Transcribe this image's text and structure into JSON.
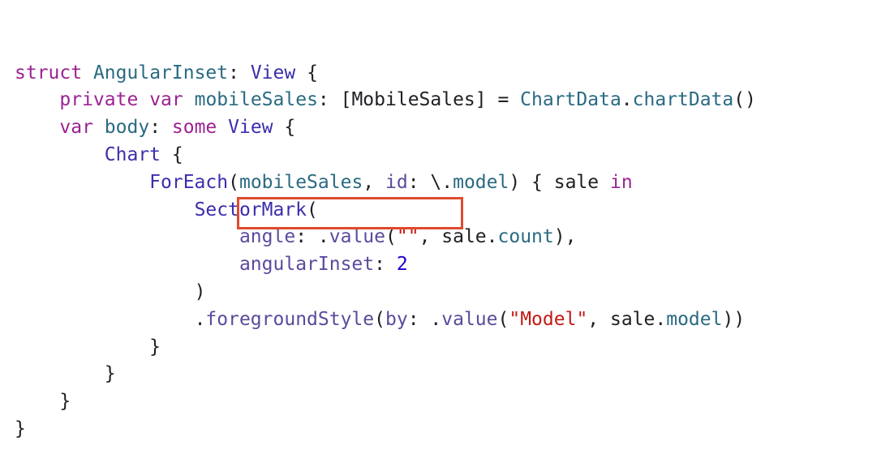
{
  "colors": {
    "keyword": "#9b2393",
    "type": "#3b2ead",
    "identifier": "#2a6a82",
    "property": "#5c4a9c",
    "string": "#c41a16",
    "number": "#1c00cf",
    "plain": "#1f1f24",
    "highlight": "#e14a2e"
  },
  "code": {
    "lines": [
      {
        "indent": "",
        "tokens": [
          {
            "t": "struct",
            "k": "keyword"
          },
          {
            "t": " ",
            "k": "plain"
          },
          {
            "t": "AngularInset",
            "k": "identifier"
          },
          {
            "t": ": ",
            "k": "plain"
          },
          {
            "t": "View",
            "k": "type"
          },
          {
            "t": " {",
            "k": "plain"
          }
        ]
      },
      {
        "indent": "    ",
        "tokens": [
          {
            "t": "private",
            "k": "keyword"
          },
          {
            "t": " ",
            "k": "plain"
          },
          {
            "t": "var",
            "k": "keyword"
          },
          {
            "t": " ",
            "k": "plain"
          },
          {
            "t": "mobileSales",
            "k": "identifier"
          },
          {
            "t": ": [MobileSales] = ",
            "k": "plain"
          },
          {
            "t": "ChartData",
            "k": "identifier"
          },
          {
            "t": ".",
            "k": "plain"
          },
          {
            "t": "chartData",
            "k": "identifier"
          },
          {
            "t": "()",
            "k": "plain"
          }
        ]
      },
      {
        "indent": "    ",
        "tokens": [
          {
            "t": "var",
            "k": "keyword"
          },
          {
            "t": " ",
            "k": "plain"
          },
          {
            "t": "body",
            "k": "identifier"
          },
          {
            "t": ": ",
            "k": "plain"
          },
          {
            "t": "some",
            "k": "keyword"
          },
          {
            "t": " ",
            "k": "plain"
          },
          {
            "t": "View",
            "k": "type"
          },
          {
            "t": " {",
            "k": "plain"
          }
        ]
      },
      {
        "indent": "        ",
        "tokens": [
          {
            "t": "Chart",
            "k": "type"
          },
          {
            "t": " {",
            "k": "plain"
          }
        ]
      },
      {
        "indent": "            ",
        "tokens": [
          {
            "t": "ForEach",
            "k": "type"
          },
          {
            "t": "(",
            "k": "plain"
          },
          {
            "t": "mobileSales",
            "k": "identifier"
          },
          {
            "t": ", ",
            "k": "plain"
          },
          {
            "t": "id",
            "k": "property"
          },
          {
            "t": ": \\.",
            "k": "plain"
          },
          {
            "t": "model",
            "k": "identifier"
          },
          {
            "t": ") { sale ",
            "k": "plain"
          },
          {
            "t": "in",
            "k": "keyword"
          }
        ]
      },
      {
        "indent": "                ",
        "tokens": [
          {
            "t": "SectorMark",
            "k": "type"
          },
          {
            "t": "(",
            "k": "plain"
          }
        ]
      },
      {
        "indent": "                    ",
        "tokens": [
          {
            "t": "angle",
            "k": "property"
          },
          {
            "t": ": .",
            "k": "plain"
          },
          {
            "t": "value",
            "k": "property"
          },
          {
            "t": "(",
            "k": "plain"
          },
          {
            "t": "\"\"",
            "k": "string"
          },
          {
            "t": ", sale.",
            "k": "plain"
          },
          {
            "t": "count",
            "k": "identifier"
          },
          {
            "t": "),",
            "k": "plain"
          }
        ]
      },
      {
        "indent": "                    ",
        "tokens": [
          {
            "t": "angularInset",
            "k": "property"
          },
          {
            "t": ": ",
            "k": "plain"
          },
          {
            "t": "2",
            "k": "number"
          }
        ]
      },
      {
        "indent": "                ",
        "tokens": [
          {
            "t": ")",
            "k": "plain"
          }
        ]
      },
      {
        "indent": "                ",
        "tokens": [
          {
            "t": ".",
            "k": "plain"
          },
          {
            "t": "foregroundStyle",
            "k": "property"
          },
          {
            "t": "(",
            "k": "plain"
          },
          {
            "t": "by",
            "k": "property"
          },
          {
            "t": ": .",
            "k": "plain"
          },
          {
            "t": "value",
            "k": "property"
          },
          {
            "t": "(",
            "k": "plain"
          },
          {
            "t": "\"Model\"",
            "k": "string"
          },
          {
            "t": ", sale.",
            "k": "plain"
          },
          {
            "t": "model",
            "k": "identifier"
          },
          {
            "t": "))",
            "k": "plain"
          }
        ]
      },
      {
        "indent": "            ",
        "tokens": [
          {
            "t": "}",
            "k": "plain"
          }
        ]
      },
      {
        "indent": "        ",
        "tokens": [
          {
            "t": "}",
            "k": "plain"
          }
        ]
      },
      {
        "indent": "    ",
        "tokens": [
          {
            "t": "}",
            "k": "plain"
          }
        ]
      },
      {
        "indent": "",
        "tokens": [
          {
            "t": "}",
            "k": "plain"
          }
        ]
      }
    ]
  }
}
